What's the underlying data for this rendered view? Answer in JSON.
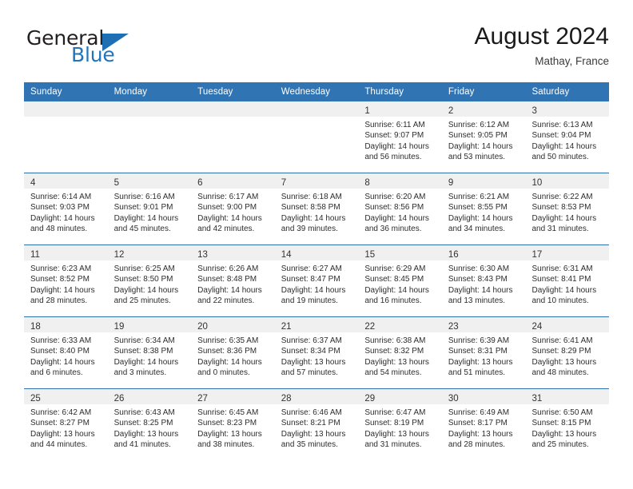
{
  "brand": {
    "word_one": "General",
    "word_two": "Blue",
    "flag_icon": "triangle-flag-icon"
  },
  "header": {
    "title": "August 2024",
    "location": "Mathay, France"
  },
  "colors": {
    "header_blue": "#3174b4",
    "brand_blue": "#2275bb",
    "daynum_band": "#f0f0f0",
    "text": "#2d2d2d"
  },
  "weekdays": [
    "Sunday",
    "Monday",
    "Tuesday",
    "Wednesday",
    "Thursday",
    "Friday",
    "Saturday"
  ],
  "weeks": [
    [
      {
        "day": "",
        "lines": []
      },
      {
        "day": "",
        "lines": []
      },
      {
        "day": "",
        "lines": []
      },
      {
        "day": "",
        "lines": []
      },
      {
        "day": "1",
        "lines": [
          "Sunrise: 6:11 AM",
          "Sunset: 9:07 PM",
          "Daylight: 14 hours",
          "and 56 minutes."
        ]
      },
      {
        "day": "2",
        "lines": [
          "Sunrise: 6:12 AM",
          "Sunset: 9:05 PM",
          "Daylight: 14 hours",
          "and 53 minutes."
        ]
      },
      {
        "day": "3",
        "lines": [
          "Sunrise: 6:13 AM",
          "Sunset: 9:04 PM",
          "Daylight: 14 hours",
          "and 50 minutes."
        ]
      }
    ],
    [
      {
        "day": "4",
        "lines": [
          "Sunrise: 6:14 AM",
          "Sunset: 9:03 PM",
          "Daylight: 14 hours",
          "and 48 minutes."
        ]
      },
      {
        "day": "5",
        "lines": [
          "Sunrise: 6:16 AM",
          "Sunset: 9:01 PM",
          "Daylight: 14 hours",
          "and 45 minutes."
        ]
      },
      {
        "day": "6",
        "lines": [
          "Sunrise: 6:17 AM",
          "Sunset: 9:00 PM",
          "Daylight: 14 hours",
          "and 42 minutes."
        ]
      },
      {
        "day": "7",
        "lines": [
          "Sunrise: 6:18 AM",
          "Sunset: 8:58 PM",
          "Daylight: 14 hours",
          "and 39 minutes."
        ]
      },
      {
        "day": "8",
        "lines": [
          "Sunrise: 6:20 AM",
          "Sunset: 8:56 PM",
          "Daylight: 14 hours",
          "and 36 minutes."
        ]
      },
      {
        "day": "9",
        "lines": [
          "Sunrise: 6:21 AM",
          "Sunset: 8:55 PM",
          "Daylight: 14 hours",
          "and 34 minutes."
        ]
      },
      {
        "day": "10",
        "lines": [
          "Sunrise: 6:22 AM",
          "Sunset: 8:53 PM",
          "Daylight: 14 hours",
          "and 31 minutes."
        ]
      }
    ],
    [
      {
        "day": "11",
        "lines": [
          "Sunrise: 6:23 AM",
          "Sunset: 8:52 PM",
          "Daylight: 14 hours",
          "and 28 minutes."
        ]
      },
      {
        "day": "12",
        "lines": [
          "Sunrise: 6:25 AM",
          "Sunset: 8:50 PM",
          "Daylight: 14 hours",
          "and 25 minutes."
        ]
      },
      {
        "day": "13",
        "lines": [
          "Sunrise: 6:26 AM",
          "Sunset: 8:48 PM",
          "Daylight: 14 hours",
          "and 22 minutes."
        ]
      },
      {
        "day": "14",
        "lines": [
          "Sunrise: 6:27 AM",
          "Sunset: 8:47 PM",
          "Daylight: 14 hours",
          "and 19 minutes."
        ]
      },
      {
        "day": "15",
        "lines": [
          "Sunrise: 6:29 AM",
          "Sunset: 8:45 PM",
          "Daylight: 14 hours",
          "and 16 minutes."
        ]
      },
      {
        "day": "16",
        "lines": [
          "Sunrise: 6:30 AM",
          "Sunset: 8:43 PM",
          "Daylight: 14 hours",
          "and 13 minutes."
        ]
      },
      {
        "day": "17",
        "lines": [
          "Sunrise: 6:31 AM",
          "Sunset: 8:41 PM",
          "Daylight: 14 hours",
          "and 10 minutes."
        ]
      }
    ],
    [
      {
        "day": "18",
        "lines": [
          "Sunrise: 6:33 AM",
          "Sunset: 8:40 PM",
          "Daylight: 14 hours",
          "and 6 minutes."
        ]
      },
      {
        "day": "19",
        "lines": [
          "Sunrise: 6:34 AM",
          "Sunset: 8:38 PM",
          "Daylight: 14 hours",
          "and 3 minutes."
        ]
      },
      {
        "day": "20",
        "lines": [
          "Sunrise: 6:35 AM",
          "Sunset: 8:36 PM",
          "Daylight: 14 hours",
          "and 0 minutes."
        ]
      },
      {
        "day": "21",
        "lines": [
          "Sunrise: 6:37 AM",
          "Sunset: 8:34 PM",
          "Daylight: 13 hours",
          "and 57 minutes."
        ]
      },
      {
        "day": "22",
        "lines": [
          "Sunrise: 6:38 AM",
          "Sunset: 8:32 PM",
          "Daylight: 13 hours",
          "and 54 minutes."
        ]
      },
      {
        "day": "23",
        "lines": [
          "Sunrise: 6:39 AM",
          "Sunset: 8:31 PM",
          "Daylight: 13 hours",
          "and 51 minutes."
        ]
      },
      {
        "day": "24",
        "lines": [
          "Sunrise: 6:41 AM",
          "Sunset: 8:29 PM",
          "Daylight: 13 hours",
          "and 48 minutes."
        ]
      }
    ],
    [
      {
        "day": "25",
        "lines": [
          "Sunrise: 6:42 AM",
          "Sunset: 8:27 PM",
          "Daylight: 13 hours",
          "and 44 minutes."
        ]
      },
      {
        "day": "26",
        "lines": [
          "Sunrise: 6:43 AM",
          "Sunset: 8:25 PM",
          "Daylight: 13 hours",
          "and 41 minutes."
        ]
      },
      {
        "day": "27",
        "lines": [
          "Sunrise: 6:45 AM",
          "Sunset: 8:23 PM",
          "Daylight: 13 hours",
          "and 38 minutes."
        ]
      },
      {
        "day": "28",
        "lines": [
          "Sunrise: 6:46 AM",
          "Sunset: 8:21 PM",
          "Daylight: 13 hours",
          "and 35 minutes."
        ]
      },
      {
        "day": "29",
        "lines": [
          "Sunrise: 6:47 AM",
          "Sunset: 8:19 PM",
          "Daylight: 13 hours",
          "and 31 minutes."
        ]
      },
      {
        "day": "30",
        "lines": [
          "Sunrise: 6:49 AM",
          "Sunset: 8:17 PM",
          "Daylight: 13 hours",
          "and 28 minutes."
        ]
      },
      {
        "day": "31",
        "lines": [
          "Sunrise: 6:50 AM",
          "Sunset: 8:15 PM",
          "Daylight: 13 hours",
          "and 25 minutes."
        ]
      }
    ]
  ]
}
